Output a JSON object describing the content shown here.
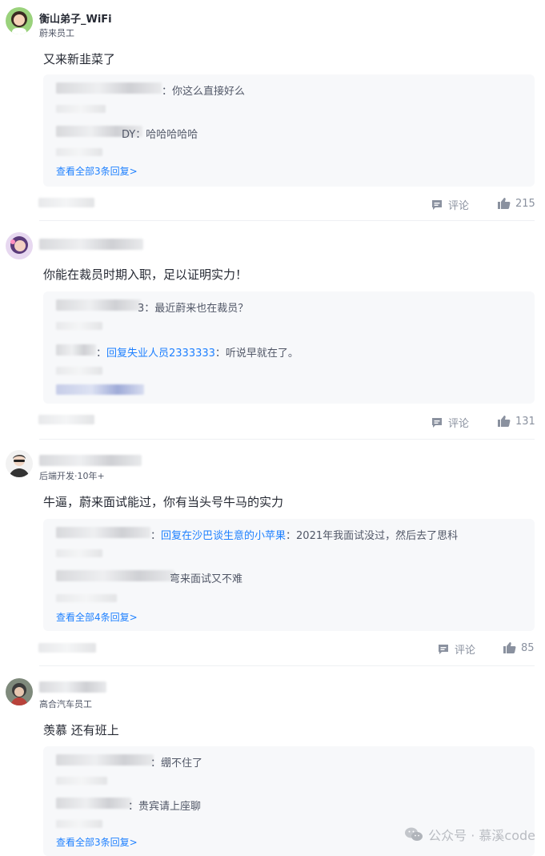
{
  "comments": [
    {
      "user_name": "衡山弟子_WiFi",
      "user_title": "蔚来员工",
      "text": "又来新韭菜了",
      "replies": [
        {
          "text": "：你这么直接好么"
        },
        {
          "text": "DY：哈哈哈哈哈"
        }
      ],
      "view_all": "查看全部3条回复>",
      "comment_label": "评论",
      "likes": "215"
    },
    {
      "user_name": "",
      "user_title": "",
      "text": "你能在裁员时期入职，足以证明实力！",
      "replies": [
        {
          "text": "3：最近蔚来也在裁员？"
        },
        {
          "prefix": "：",
          "link": "回复失业人员2333333",
          "text": "：听说早就在了。"
        }
      ],
      "view_all": "",
      "comment_label": "评论",
      "likes": "131"
    },
    {
      "user_name": "",
      "user_title": "后端开发·10年+",
      "text": "牛逼，蔚来面试能过，你有当头号牛马的实力",
      "replies": [
        {
          "prefix": "：",
          "link": "回复在沙巴谈生意的小苹果",
          "text": "：2021年我面试没过，然后去了思科"
        },
        {
          "text": "弯来面试又不难"
        }
      ],
      "view_all": "查看全部4条回复>",
      "comment_label": "评论",
      "likes": "85"
    },
    {
      "user_name": "",
      "user_title": "高合汽车员工",
      "text": "羡慕 还有班上",
      "replies": [
        {
          "text": "：绷不住了"
        },
        {
          "text": "：贵宾请上座聊"
        }
      ],
      "view_all": "查看全部3条回复>",
      "comment_label": "",
      "likes": ""
    }
  ],
  "watermark": "公众号 · 慕溪code",
  "icons": {
    "comment": "comment-icon",
    "like": "thumbs-up-icon",
    "wechat": "wechat-icon"
  },
  "colors": {
    "link": "#1e80ff",
    "reply_bg": "#f7f8fa",
    "text": "#252933",
    "muted": "#8a919f"
  }
}
